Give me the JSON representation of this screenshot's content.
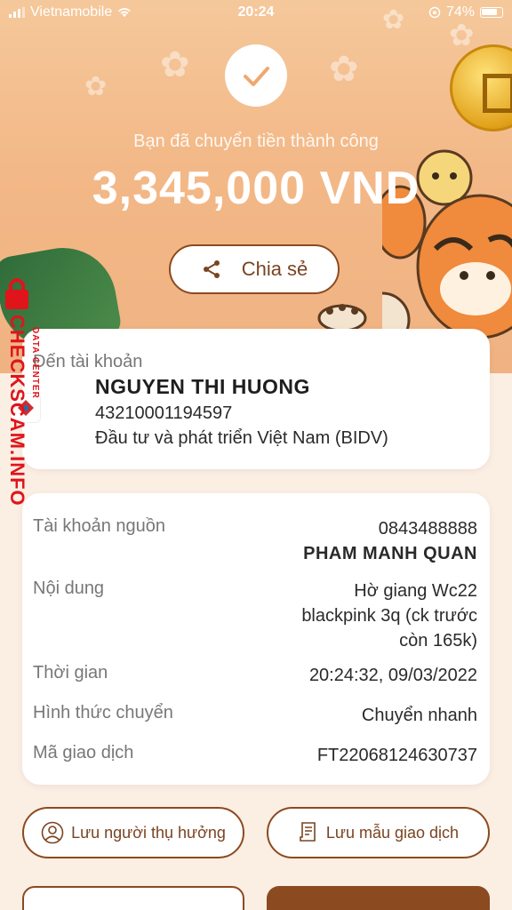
{
  "status_bar": {
    "carrier": "Vietnamobile",
    "time": "20:24",
    "battery": "74%"
  },
  "hero": {
    "success_text": "Bạn đã chuyển tiền thành công",
    "amount": "3,345,000 VND",
    "share_label": "Chia sẻ"
  },
  "recipient": {
    "label": "Đến tài khoản",
    "name": "NGUYEN THI HUONG",
    "account": "43210001194597",
    "bank": "Đầu tư và phát triển Việt Nam (BIDV)"
  },
  "details": {
    "source_label": "Tài khoản nguồn",
    "source_account": "0843488888",
    "source_name": "PHAM MANH QUAN",
    "content_label": "Nội dung",
    "content_lines": [
      "Hờ giang Wc22",
      "blackpink 3q (ck trước",
      "còn 165k)"
    ],
    "time_label": "Thời gian",
    "time_value": "20:24:32, 09/03/2022",
    "method_label": "Hình thức chuyển",
    "method_value": "Chuyển nhanh",
    "txn_label": "Mã giao dịch",
    "txn_value": "FT22068124630737"
  },
  "actions": {
    "save_beneficiary": "Lưu người thụ hưởng",
    "save_template": "Lưu mẫu giao dịch"
  },
  "watermark": {
    "main": "CHECKSCAM.INFO",
    "sub": "DATA CENTER"
  },
  "colors": {
    "accent": "#8b4a20",
    "hero_bg": "#f3b887",
    "watermark": "#e0141b"
  }
}
